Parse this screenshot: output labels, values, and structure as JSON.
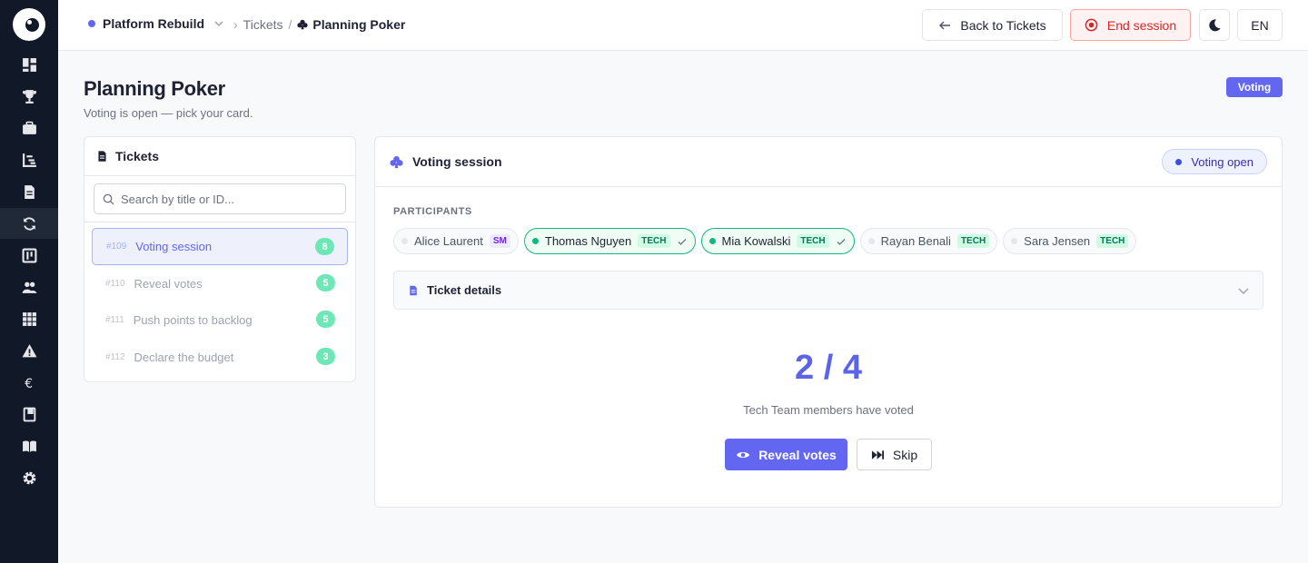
{
  "sidebar": {
    "items": [
      {
        "icon": "dashboard-icon"
      },
      {
        "icon": "trophy-icon"
      },
      {
        "icon": "briefcase-icon"
      },
      {
        "icon": "hierarchy-icon"
      },
      {
        "icon": "document-icon"
      },
      {
        "icon": "refresh-icon",
        "active": true
      },
      {
        "icon": "board-icon"
      },
      {
        "icon": "team-icon"
      },
      {
        "icon": "grid-icon"
      },
      {
        "icon": "warning-icon"
      },
      {
        "icon": "euro-icon"
      },
      {
        "icon": "notebook-icon"
      },
      {
        "icon": "book-icon"
      },
      {
        "icon": "settings-icon"
      }
    ]
  },
  "topbar": {
    "project": "Platform Rebuild",
    "breadcrumb": {
      "parent": "Tickets",
      "separator": "/",
      "current": "Planning Poker"
    },
    "back_label": "Back to Tickets",
    "end_label": "End session",
    "lang_label": "EN"
  },
  "header": {
    "title": "Planning Poker",
    "subtitle": "Voting is open — pick your card.",
    "status": "Voting"
  },
  "tickets": {
    "title": "Tickets",
    "search_placeholder": "Search by title or ID...",
    "items": [
      {
        "id": "#109",
        "title": "Voting session",
        "points": "8",
        "active": true
      },
      {
        "id": "#110",
        "title": "Reveal votes",
        "points": "5"
      },
      {
        "id": "#111",
        "title": "Push points to backlog",
        "points": "5"
      },
      {
        "id": "#112",
        "title": "Declare the budget",
        "points": "3"
      }
    ]
  },
  "session": {
    "title": "Voting session",
    "status": "Voting open",
    "participants_label": "PARTICIPANTS",
    "participants": [
      {
        "name": "Alice Laurent",
        "role": "SM",
        "voted": false
      },
      {
        "name": "Thomas Nguyen",
        "role": "TECH",
        "voted": true
      },
      {
        "name": "Mia Kowalski",
        "role": "TECH",
        "voted": true
      },
      {
        "name": "Rayan Benali",
        "role": "TECH",
        "voted": false
      },
      {
        "name": "Sara Jensen",
        "role": "TECH",
        "voted": false
      }
    ],
    "details_label": "Ticket details",
    "vote_count": "2 / 4",
    "vote_count_label": "Tech Team members have voted",
    "reveal_label": "Reveal votes",
    "skip_label": "Skip"
  },
  "colors": {
    "accent": "#6366f1",
    "sidebar": "#111827",
    "danger": "#dc2626",
    "success": "#10b981"
  }
}
